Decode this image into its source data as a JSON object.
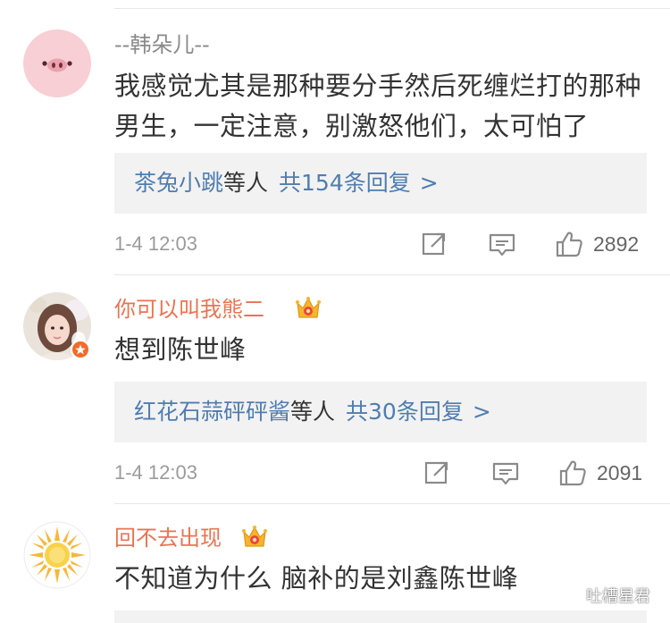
{
  "comments": [
    {
      "username": "--韩朵儿--",
      "username_style": "plain",
      "text": "我感觉尤其是那种要分手然后死缠烂打的那种男生，一定注意，别激怒他们，太可怕了",
      "replies": {
        "names": "茶兔小跳",
        "suffix": "等人",
        "count_text": "共154条回复",
        "arrow": ">"
      },
      "timestamp": "1-4 12:03",
      "likes": "2892",
      "avatar_icon": "pig-face-icon"
    },
    {
      "username": "你可以叫我熊二",
      "username_style": "vip",
      "text": "想到陈世峰",
      "replies": {
        "names": "红花石蒜砰砰酱",
        "suffix": "等人",
        "count_text": "共30条回复",
        "arrow": ">"
      },
      "timestamp": "1-4 12:03",
      "likes": "2091",
      "avatar_icon": "girl-photo-icon"
    },
    {
      "username": "回不去出现",
      "username_style": "vip",
      "text": "不知道为什么 脑补的是刘鑫陈世峰",
      "avatar_icon": "sun-icon"
    }
  ],
  "watermark": {
    "text": "吐槽星君",
    "icon": "wechat-icon"
  },
  "colors": {
    "vip_name": "#eb7350",
    "link_blue": "#507daf",
    "reply_bg": "#f2f2f2",
    "body_text": "#333333",
    "meta_gray": "#9b9b9b"
  }
}
